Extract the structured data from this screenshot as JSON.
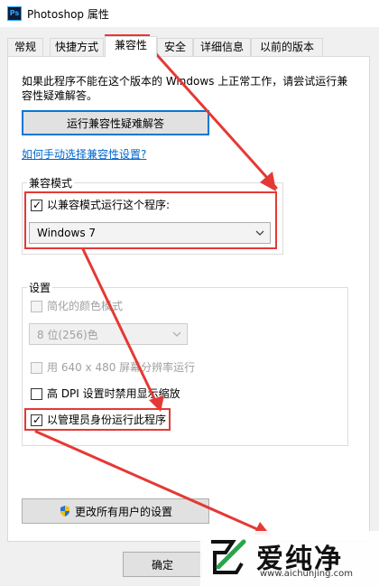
{
  "window": {
    "title": "Photoshop 属性",
    "app_icon_text": "Ps"
  },
  "tabs": [
    {
      "label": "常规"
    },
    {
      "label": "快捷方式"
    },
    {
      "label": "兼容性"
    },
    {
      "label": "安全"
    },
    {
      "label": "详细信息"
    },
    {
      "label": "以前的版本"
    }
  ],
  "active_tab": "兼容性",
  "compat": {
    "info": "如果此程序不能在这个版本的 Windows 上正常工作，请尝试运行兼容性疑难解答。",
    "troubleshoot_button": "运行兼容性疑难解答",
    "manual_link": "如何手动选择兼容性设置?",
    "mode_group_label": "兼容模式",
    "mode_checkbox_label": "以兼容模式运行这个程序:",
    "mode_checked": true,
    "mode_select_value": "Windows 7"
  },
  "settings": {
    "group_label": "设置",
    "reduced_color_label": "简化的颜色模式",
    "reduced_color_checked": false,
    "color_select_value": "8 位(256)色",
    "res_640_label": "用 640 x 480 屏幕分辨率运行",
    "res_640_checked": false,
    "high_dpi_label": "高 DPI 设置时禁用显示缩放",
    "high_dpi_checked": false,
    "admin_label": "以管理员身份运行此程序",
    "admin_checked": true
  },
  "all_users_button": "更改所有用户的设置",
  "ok_button": "确定",
  "watermark": {
    "brand": "爱纯净",
    "url": "www.aichunjing.com"
  },
  "colors": {
    "annotation_red": "#e53935",
    "focus_blue": "#0078d7",
    "link_blue": "#0066cc"
  }
}
